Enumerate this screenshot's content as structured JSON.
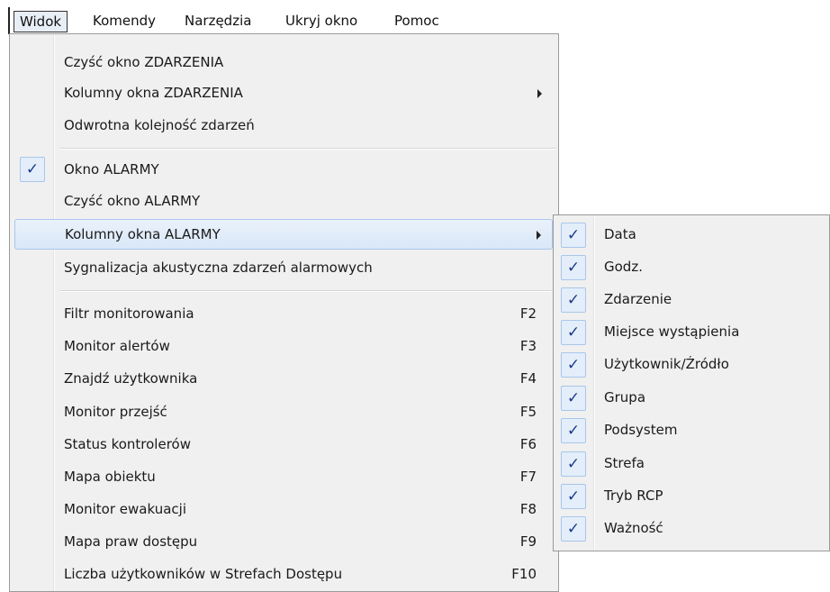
{
  "menubar": {
    "items": [
      "Widok",
      "Komendy",
      "Narzędzia",
      "Ukryj okno",
      "Pomoc"
    ]
  },
  "dropdown": {
    "items": [
      {
        "label": "Czyść okno ZDARZENIA"
      },
      {
        "label": "Kolumny okna ZDARZENIA",
        "submenu": true
      },
      {
        "label": "Odwrotna kolejność zdarzeń"
      },
      {
        "label": "Okno ALARMY",
        "checked": true
      },
      {
        "label": "Czyść okno ALARMY"
      },
      {
        "label": "Kolumny okna ALARMY",
        "submenu": true,
        "highlighted": true
      },
      {
        "label": "Sygnalizacja akustyczna zdarzeń alarmowych"
      },
      {
        "label": "Filtr monitorowania",
        "shortcut": "F2"
      },
      {
        "label": "Monitor alertów",
        "shortcut": "F3"
      },
      {
        "label": "Znajdź użytkownika",
        "shortcut": "F4"
      },
      {
        "label": "Monitor przejść",
        "shortcut": "F5"
      },
      {
        "label": "Status kontrolerów",
        "shortcut": "F6"
      },
      {
        "label": "Mapa obiektu",
        "shortcut": "F7"
      },
      {
        "label": "Monitor ewakuacji",
        "shortcut": "F8"
      },
      {
        "label": "Mapa praw dostępu",
        "shortcut": "F9"
      },
      {
        "label": "Liczba użytkowników w Strefach Dostępu",
        "shortcut": "F10"
      }
    ]
  },
  "submenu": {
    "check_glyph": "✓",
    "items": [
      "Data",
      "Godz.",
      "Zdarzenie",
      "Miejsce wystąpienia",
      "Użytkownik/Źródło",
      "Grupa",
      "Podsystem",
      "Strefa",
      "Tryb RCP",
      "Ważność"
    ]
  }
}
